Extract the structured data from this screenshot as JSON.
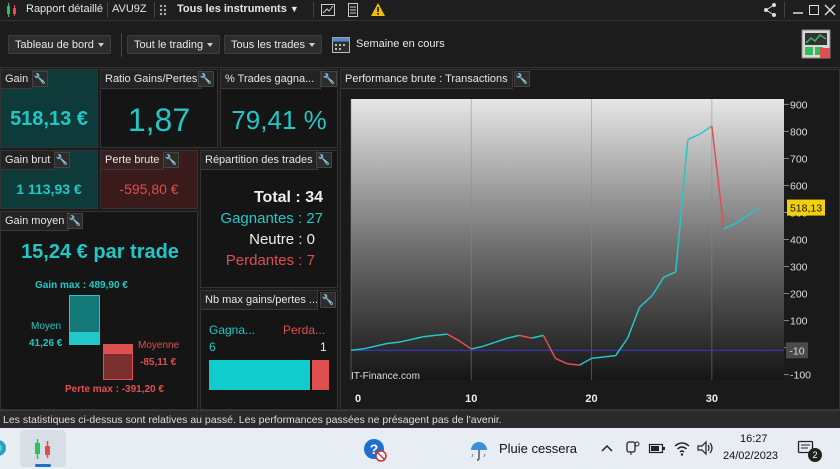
{
  "topbar": {
    "title": "Rapport détaillé",
    "account": "AVU9Z",
    "instruments": "Tous les instruments"
  },
  "toolbar": {
    "dashboard": "Tableau de bord",
    "trading": "Tout le trading",
    "trades": "Tous les trades",
    "period": "Semaine en cours"
  },
  "panels": {
    "gain": {
      "title": "Gain",
      "value": "518,13 €"
    },
    "ratio": {
      "title": "Ratio Gains/Pertes",
      "value": "1,87"
    },
    "pct": {
      "title": "% Trades gagna...",
      "value": "79,41 %"
    },
    "gross_gain": {
      "title": "Gain brut",
      "value": "1 113,93 €"
    },
    "gross_loss": {
      "title": "Perte brute",
      "value": "-595,80 €"
    },
    "distribution": {
      "title": "Répartition des trades",
      "total": "Total : 34",
      "winners": "Gagnantes : 27",
      "neutral": "Neutre : 0",
      "losers": "Perdantes : 7"
    },
    "avg_gain": {
      "title": "Gain moyen",
      "value": "15,24 € par trade",
      "max_gain_label": "Gain max :",
      "max_gain": "489,90 €",
      "avg_label": "Moyen",
      "avg_gain": "41,26 €",
      "avg_loss_label": "Moyenne",
      "avg_loss": "-85,11 €",
      "max_loss_label": "Perte max :",
      "max_loss": "-391,20 €"
    },
    "streak": {
      "title": "Nb max gains/pertes ...",
      "win_label": "Gagna...",
      "loss_label": "Perda...",
      "win_value": "6",
      "loss_value": "1",
      "win_count": 6,
      "loss_count": 1
    },
    "perf": {
      "title": "Performance brute : Transactions",
      "watermark": "IT-Finance.com",
      "last_value": "518,13",
      "zero_value": "-10"
    }
  },
  "chart_data": {
    "type": "line",
    "title": "Performance brute : Transactions",
    "x_ticks": [
      0,
      10,
      20,
      30
    ],
    "y_ticks": [
      900,
      800,
      700,
      600,
      500,
      400,
      300,
      200,
      100,
      0,
      -100
    ],
    "xlim": [
      0,
      36
    ],
    "ylim": [
      -120,
      920
    ],
    "baseline": -10,
    "last_value": 518.13,
    "x": [
      0,
      1,
      2,
      3,
      4,
      5,
      6,
      7,
      8,
      9,
      10,
      11,
      12,
      13,
      14,
      15,
      16,
      17,
      18,
      19,
      20,
      21,
      22,
      23,
      24,
      25,
      26,
      27,
      28,
      29,
      30,
      31,
      32,
      33,
      34
    ],
    "y": [
      -10,
      -5,
      5,
      15,
      20,
      30,
      40,
      45,
      50,
      25,
      -5,
      5,
      20,
      35,
      45,
      35,
      45,
      -40,
      -60,
      -65,
      -40,
      -35,
      -30,
      35,
      150,
      190,
      260,
      280,
      770,
      790,
      820,
      440,
      460,
      490,
      518
    ],
    "colors": {
      "up": "#22c7c7",
      "down": "#e04f4f",
      "baseline": "#3a3ad0"
    }
  },
  "footer": {
    "disclaimer": "Les statistiques ci-dessus sont relatives au passé. Les performances passées ne présagent pas de l'avenir."
  },
  "taskbar": {
    "weather": "Pluie cessera",
    "time": "16:27",
    "date": "24/02/2023",
    "notifications": "2"
  }
}
